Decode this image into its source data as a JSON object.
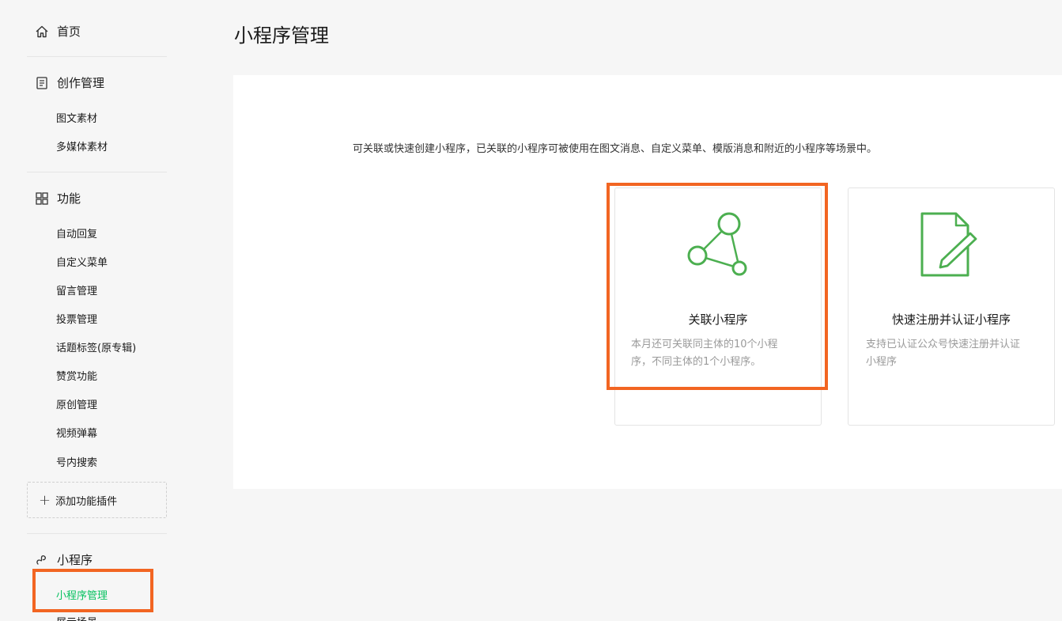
{
  "sidebar": {
    "home": {
      "label": "首页",
      "icon": "home-icon"
    },
    "creation": {
      "label": "创作管理",
      "icon": "document-icon",
      "items": [
        "图文素材",
        "多媒体素材"
      ]
    },
    "features": {
      "label": "功能",
      "icon": "grid-icon",
      "items": [
        "自动回复",
        "自定义菜单",
        "留言管理",
        "投票管理",
        "话题标签(原专辑)",
        "赞赏功能",
        "原创管理",
        "视频弹幕",
        "号内搜索"
      ]
    },
    "add_plugin": "添加功能插件",
    "miniprogram": {
      "label": "小程序",
      "icon": "miniprogram-icon",
      "items": [
        "小程序管理",
        "展示场景"
      ]
    }
  },
  "main": {
    "title": "小程序管理",
    "description": "可关联或快速创建小程序，已关联的小程序可被使用在图文消息、自定义菜单、模版消息和附近的小程序等场景中。",
    "cards": [
      {
        "title": "关联小程序",
        "desc_line1": "本月还可关联同主体的10个小程",
        "desc_line2": "序，不同主体的1个小程序。",
        "icon": "link-nodes-icon"
      },
      {
        "title": "快速注册并认证小程序",
        "desc_line1": "支持已认证公众号快速注册并认证",
        "desc_line2": "小程序",
        "icon": "edit-document-icon"
      }
    ]
  },
  "colors": {
    "accent": "#07c160",
    "highlight": "#f26522",
    "icon_green": "#4caf50"
  }
}
